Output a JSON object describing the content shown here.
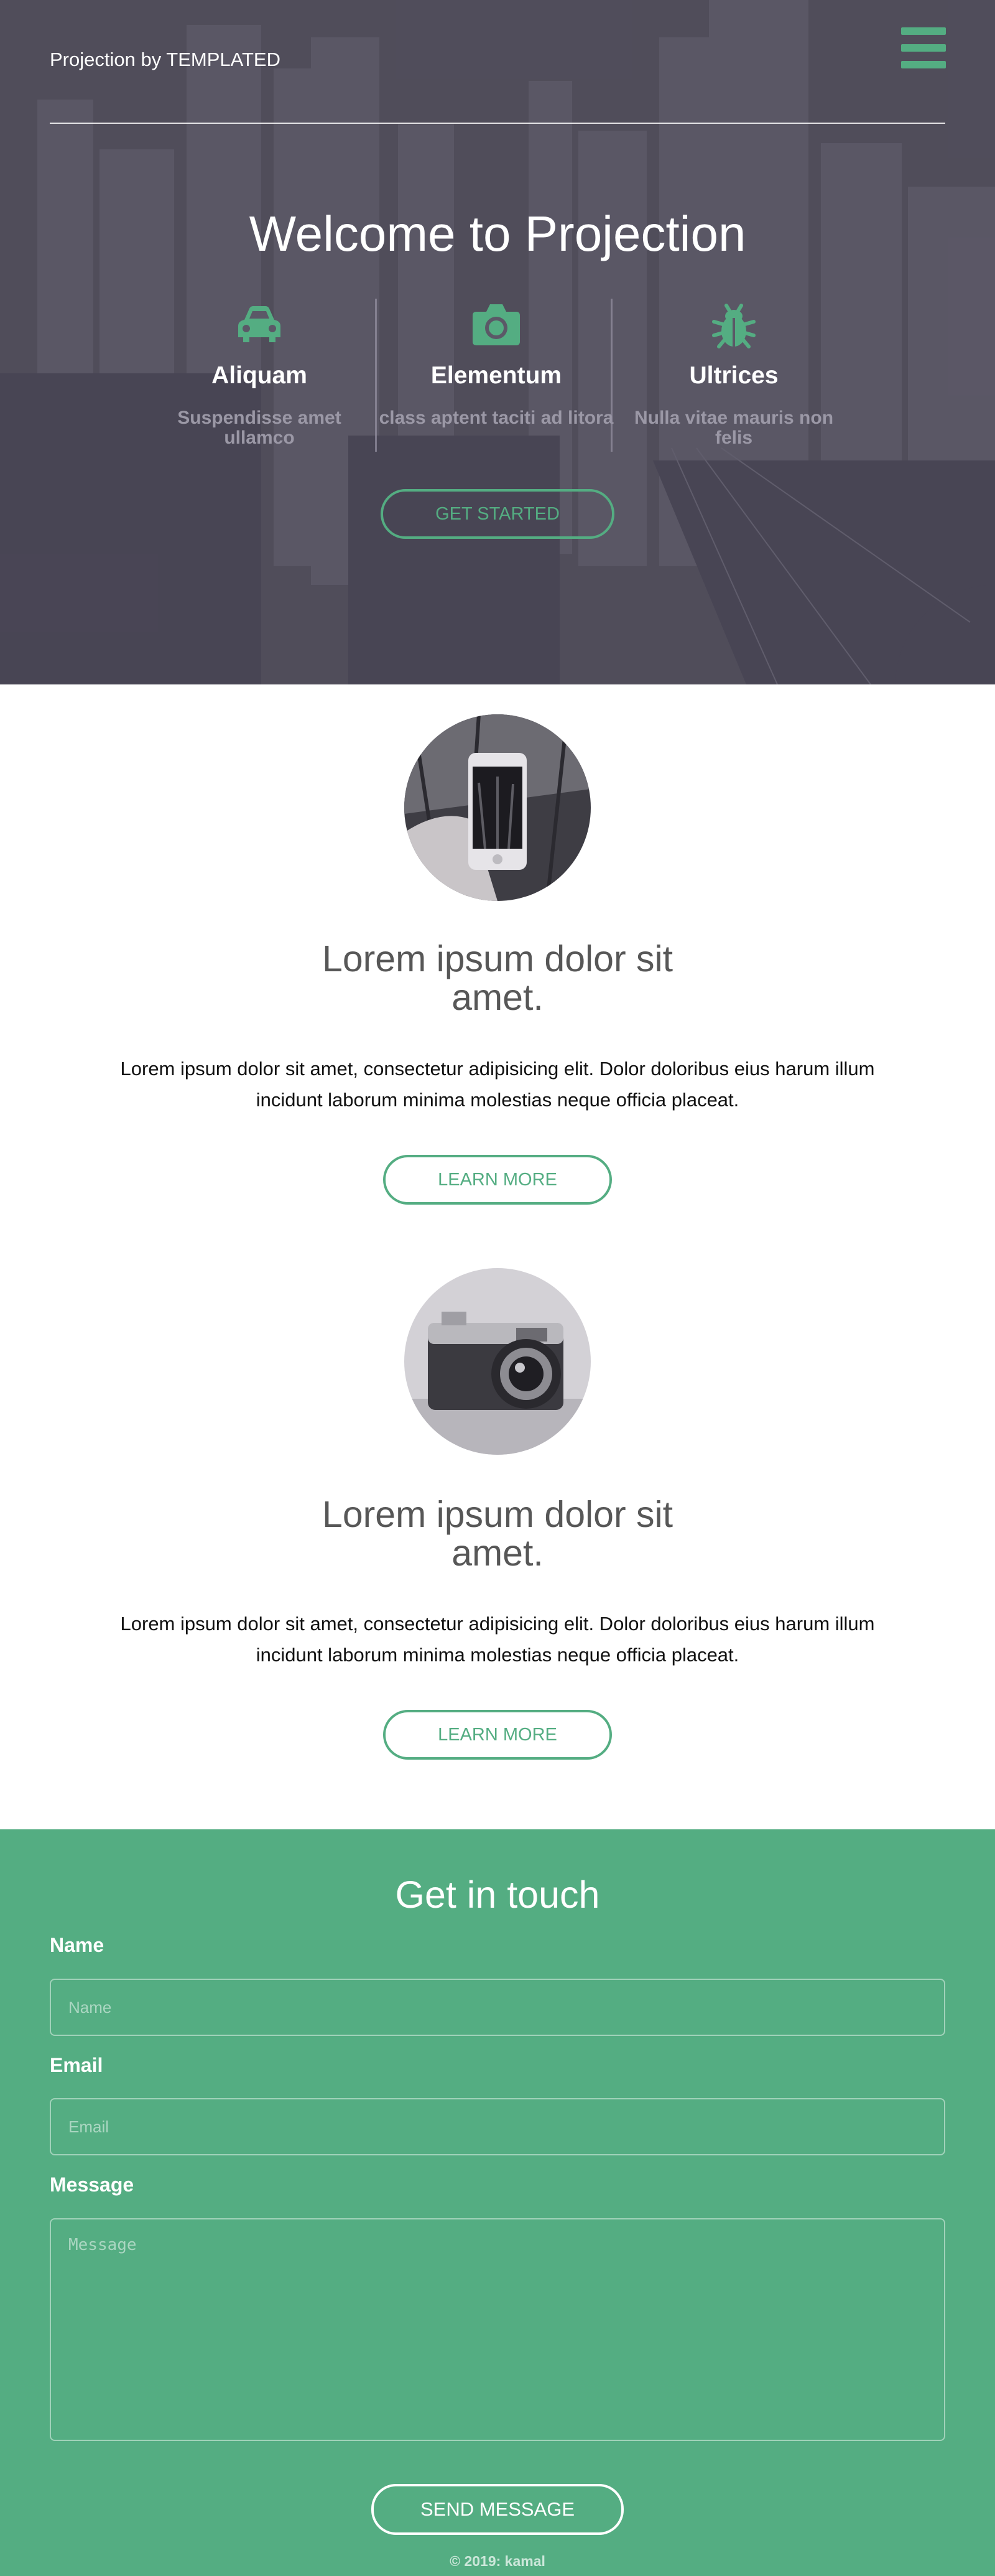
{
  "header": {
    "brand": "Projection by TEMPLATED",
    "menu_icon": "hamburger-menu-icon"
  },
  "hero": {
    "title": "Welcome to Projection",
    "features": [
      {
        "icon": "car-icon",
        "title": "Aliquam",
        "text": "Suspendisse amet ullamco"
      },
      {
        "icon": "camera-icon",
        "title": "Elementum",
        "text": "class aptent taciti ad litora"
      },
      {
        "icon": "bug-icon",
        "title": "Ultrices",
        "text": "Nulla vitae mauris non felis"
      }
    ],
    "cta": "GET STARTED"
  },
  "articles": [
    {
      "image": "phone-photo",
      "title": "Lorem ipsum dolor sit amet.",
      "body": "Lorem ipsum dolor sit amet, consectetur adipisicing elit. Dolor doloribus eius harum illum incidunt laborum minima molestias neque officia placeat.",
      "button": "LEARN MORE"
    },
    {
      "image": "camera-photo",
      "title": "Lorem ipsum dolor sit amet.",
      "body": "Lorem ipsum dolor sit amet, consectetur adipisicing elit. Dolor doloribus eius harum illum incidunt laborum minima molestias neque officia placeat.",
      "button": "LEARN MORE"
    }
  ],
  "contact": {
    "title": "Get in touch",
    "name_label": "Name",
    "name_placeholder": "Name",
    "name_value": "",
    "email_label": "Email",
    "email_placeholder": "Email",
    "email_value": "",
    "message_label": "Message",
    "message_placeholder": "Message",
    "message_value": "",
    "submit": "SEND MESSAGE"
  },
  "footer": {
    "copyright": "© 2019: kamal"
  },
  "colors": {
    "accent": "#54ad82",
    "hero_overlay": "#4f4c5c",
    "feature_text": "#9b98a6",
    "heading_gray": "#575757"
  }
}
